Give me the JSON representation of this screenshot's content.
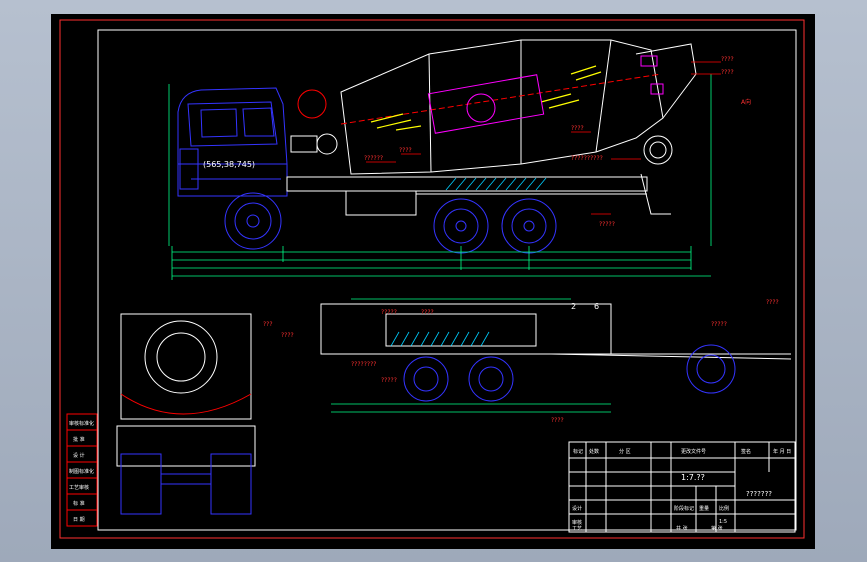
{
  "drawing": {
    "coord_label": "(565,38,745)",
    "scale_label": "1:7.??",
    "drawing_no": "???????",
    "labels_marks": [
      "????",
      "????",
      "??????",
      "????",
      "????",
      "??????????",
      "?????",
      "???",
      "????",
      "????????",
      "?????",
      "?????",
      "????",
      "????",
      "?????",
      "????",
      "???????",
      "????",
      "???",
      "???"
    ],
    "side_strip": [
      "审核标准化",
      "批  准",
      "设  计",
      "制图标准化",
      "工艺审核",
      "标  准",
      "日  期"
    ],
    "title_block": {
      "header": [
        "标记",
        "处数",
        "分  区",
        "更改文件号",
        "签名",
        "年 月 日"
      ],
      "left_rows": [
        "设计",
        "审核",
        "工艺"
      ],
      "mid_cols": [
        "阶段标记",
        "重量",
        "比例"
      ],
      "sheet": [
        "共  张",
        "第  张"
      ],
      "scale_value": "1:5"
    },
    "view_labels": [
      "A向",
      "2",
      "6"
    ]
  },
  "colors": {
    "frame": "#ff0000",
    "outline": "#ffffff",
    "cab": "#2a2aff",
    "wheels": "#3030ff",
    "dims": "#00ff88",
    "yellow": "#ffff00",
    "magenta": "#ff00ff",
    "cyan": "#00ffff"
  }
}
